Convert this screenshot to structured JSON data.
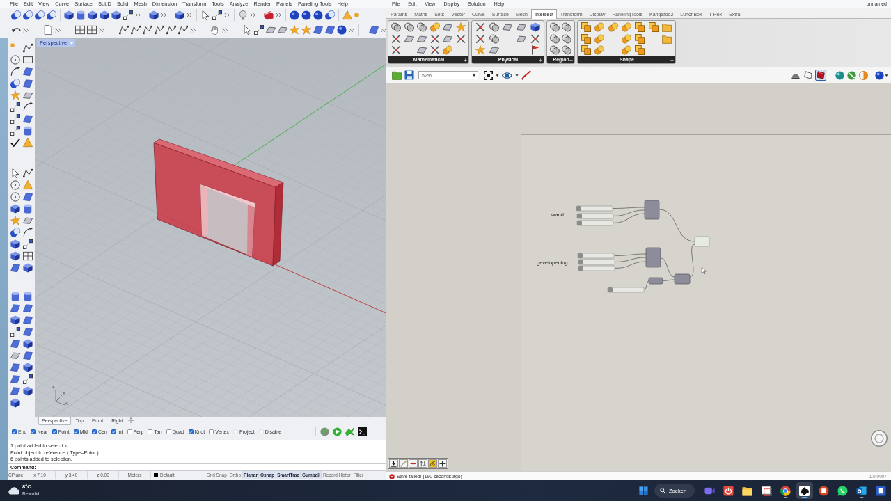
{
  "rhino": {
    "menu": [
      "File",
      "Edit",
      "View",
      "Curve",
      "Surface",
      "SubD",
      "Solid",
      "Mesh",
      "Dimension",
      "Transform",
      "Tools",
      "Analyze",
      "Render",
      "Panels",
      "Paneling Tools",
      "Help"
    ],
    "viewport": {
      "title": "Perspective",
      "axes": [
        "z",
        "y",
        "x"
      ]
    },
    "viewport_tabs": [
      {
        "label": "Perspective",
        "selected": true
      },
      {
        "label": "Top",
        "selected": false
      },
      {
        "label": "Front",
        "selected": false
      },
      {
        "label": "Right",
        "selected": false
      }
    ],
    "osnaps": [
      {
        "label": "End",
        "kind": "checkbox",
        "checked": true
      },
      {
        "label": "Near",
        "kind": "checkbox",
        "checked": true
      },
      {
        "label": "Point",
        "kind": "checkbox",
        "checked": true
      },
      {
        "label": "Mid",
        "kind": "checkbox",
        "checked": true
      },
      {
        "label": "Cen",
        "kind": "checkbox",
        "checked": true
      },
      {
        "label": "Int",
        "kind": "checkbox",
        "checked": true
      },
      {
        "label": "Perp",
        "kind": "checkbox",
        "checked": false
      },
      {
        "label": "Tan",
        "kind": "checkbox",
        "checked": false
      },
      {
        "label": "Quad",
        "kind": "checkbox",
        "checked": false
      },
      {
        "label": "Knot",
        "kind": "checkbox",
        "checked": true
      },
      {
        "label": "Vertex",
        "kind": "checkbox",
        "checked": false
      },
      {
        "label": "Project",
        "kind": "radio",
        "checked": false
      },
      {
        "label": "Disable",
        "kind": "radio",
        "checked": false
      }
    ],
    "command_history": [
      "1 point added to selection.",
      "Point object to reference ( Type=Point )",
      "6 points added to selection."
    ],
    "command_prompt": "Command:",
    "status_cells": [
      "CPlane",
      "x 7.10",
      "y 3.40",
      "z 0.00",
      "Meters"
    ],
    "layer": {
      "name": "Default",
      "color": "#000000"
    },
    "status_toggles": [
      {
        "label": "Grid Snap",
        "on": false
      },
      {
        "label": "Ortho",
        "on": false
      },
      {
        "label": "Planar",
        "on": true
      },
      {
        "label": "Osnap",
        "on": true
      },
      {
        "label": "SmartTrac",
        "on": true
      },
      {
        "label": "Gumball",
        "on": true
      },
      {
        "label": "Record Histor",
        "on": false
      },
      {
        "label": "Filter",
        "on": false
      }
    ]
  },
  "grasshopper": {
    "menu": [
      "File",
      "Edit",
      "View",
      "Display",
      "Solution",
      "Help"
    ],
    "document": "unnamed",
    "tabs": [
      {
        "label": "Params",
        "selected": false
      },
      {
        "label": "Maths",
        "selected": false
      },
      {
        "label": "Sets",
        "selected": false
      },
      {
        "label": "Vector",
        "selected": false
      },
      {
        "label": "Curve",
        "selected": false
      },
      {
        "label": "Surface",
        "selected": false
      },
      {
        "label": "Mesh",
        "selected": false
      },
      {
        "label": "Intersect",
        "selected": true
      },
      {
        "label": "Transform",
        "selected": false
      },
      {
        "label": "Display",
        "selected": false
      },
      {
        "label": "PanelingTools",
        "selected": false
      },
      {
        "label": "Kangaroo2",
        "selected": false
      },
      {
        "label": "LunchBox",
        "selected": false
      },
      {
        "label": "T-Rex",
        "selected": false
      },
      {
        "label": "Extra",
        "selected": false
      }
    ],
    "panels": [
      "Mathematical",
      "Physical",
      "Region",
      "Shape"
    ],
    "zoom": "52%",
    "display_modes": [
      {
        "selected": false
      },
      {
        "selected": false
      },
      {
        "selected": true
      }
    ],
    "canvas_labels": [
      "wand",
      "gevelopening"
    ],
    "canvas_tools": [
      {
        "active": false
      },
      {
        "active": false
      },
      {
        "active": false
      },
      {
        "active": false
      },
      {
        "active": true
      },
      {
        "active": false
      }
    ],
    "status": {
      "message": "Save failed! (190 seconds ago)",
      "version": "1.0.0007"
    }
  },
  "taskbar": {
    "weather": {
      "temperature": "8°C",
      "condition": "Bewolkt"
    },
    "search": "Zoeken",
    "apps": [
      {
        "running": false,
        "active": false
      },
      {
        "running": false,
        "active": false
      },
      {
        "running": false,
        "active": false
      },
      {
        "running": false,
        "active": false
      },
      {
        "running": true,
        "active": false
      },
      {
        "running": true,
        "active": true
      },
      {
        "running": false,
        "active": false
      },
      {
        "running": false,
        "active": false
      },
      {
        "running": true,
        "active": false
      },
      {
        "running": false,
        "active": false
      }
    ]
  }
}
